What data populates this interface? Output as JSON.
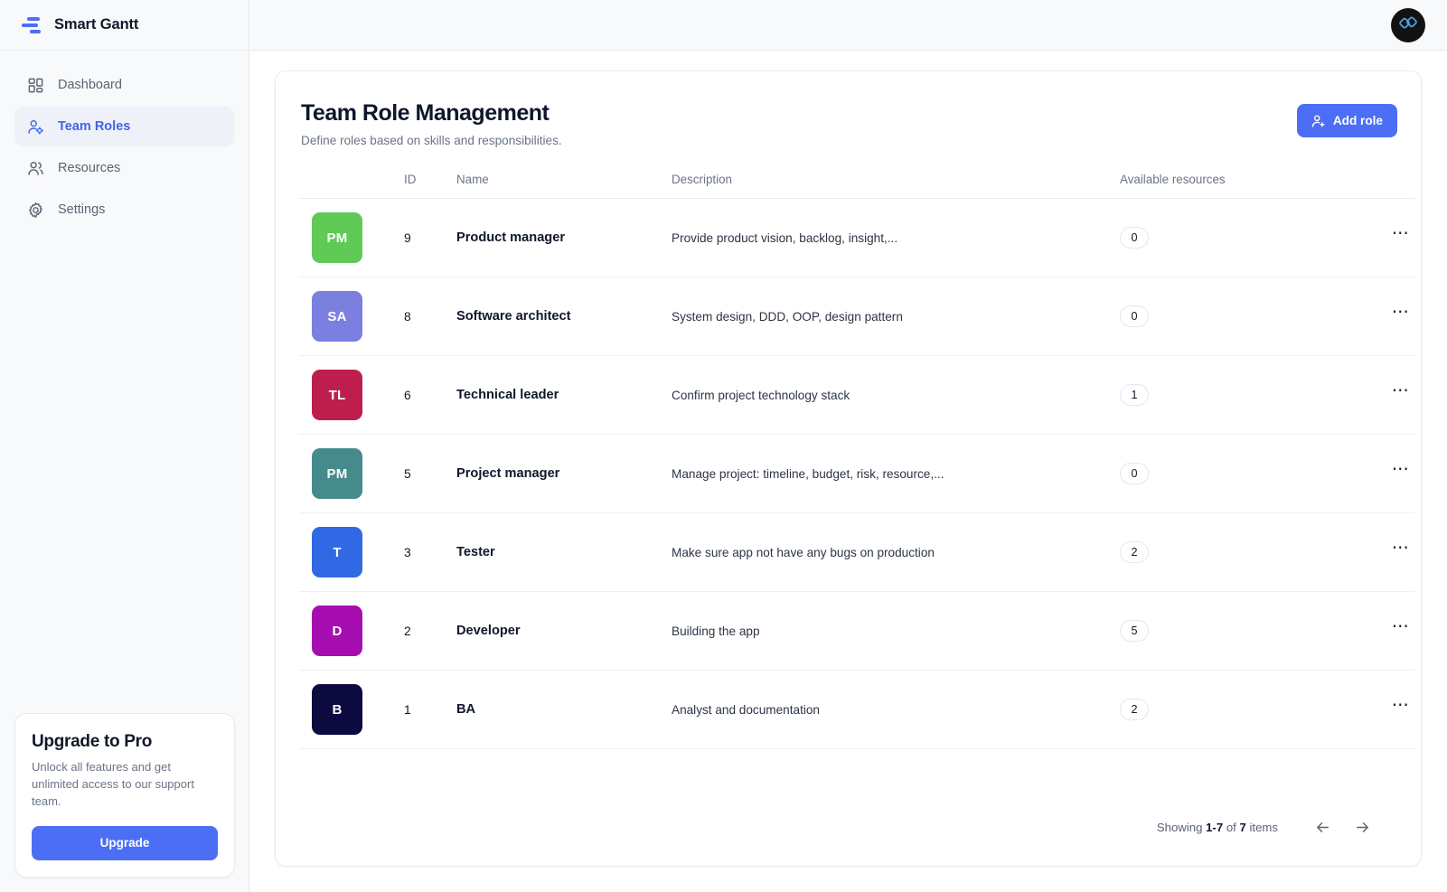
{
  "sidebar": {
    "brand": {
      "name": "Smart Gantt",
      "logo_icon": "gantt-bars-icon"
    },
    "items": [
      {
        "label": "Dashboard",
        "icon": "grid-icon",
        "active": false
      },
      {
        "label": "Team Roles",
        "icon": "user-gear-icon",
        "active": true
      },
      {
        "label": "Resources",
        "icon": "users-icon",
        "active": false
      },
      {
        "label": "Settings",
        "icon": "gear-icon",
        "active": false
      }
    ],
    "upgrade": {
      "title": "Upgrade to Pro",
      "description": "Unlock all features and get unlimited access to our support team.",
      "button_label": "Upgrade"
    }
  },
  "topbar": {
    "avatar_icon": "interlocking-diamonds-logo-icon"
  },
  "page": {
    "title": "Team Role Management",
    "subtitle": "Define roles based on skills and responsibilities.",
    "add_button_label": "Add role",
    "add_button_icon": "user-plus-icon"
  },
  "table": {
    "columns": [
      "",
      "ID",
      "Name",
      "Description",
      "Available resources",
      ""
    ],
    "headers": {
      "avatar": "",
      "id": "ID",
      "name": "Name",
      "description": "Description",
      "resources": "Available resources",
      "actions": ""
    },
    "rows": [
      {
        "initials": "PM",
        "color": "#5FCA56",
        "id": "9",
        "name": "Product manager",
        "description": "Provide product vision, backlog, insight,...",
        "resources": "0",
        "menu_icon": "ellipsis-icon"
      },
      {
        "initials": "SA",
        "color": "#7B7FE0",
        "id": "8",
        "name": "Software architect",
        "description": "System design, DDD, OOP, design pattern",
        "resources": "0",
        "menu_icon": "ellipsis-icon"
      },
      {
        "initials": "TL",
        "color": "#BE1E4E",
        "id": "6",
        "name": "Technical leader",
        "description": "Confirm project technology stack",
        "resources": "1",
        "menu_icon": "ellipsis-icon"
      },
      {
        "initials": "PM",
        "color": "#458B8B",
        "id": "5",
        "name": "Project manager",
        "description": "Manage project: timeline, budget, risk, resource,...",
        "resources": "0",
        "menu_icon": "ellipsis-icon"
      },
      {
        "initials": "T",
        "color": "#3069E3",
        "id": "3",
        "name": "Tester",
        "description": "Make sure app not have any bugs on production",
        "resources": "2",
        "menu_icon": "ellipsis-icon"
      },
      {
        "initials": "D",
        "color": "#A60DB0",
        "id": "2",
        "name": "Developer",
        "description": "Building the app",
        "resources": "5",
        "menu_icon": "ellipsis-icon"
      },
      {
        "initials": "B",
        "color": "#0C0A3E",
        "id": "1",
        "name": "BA",
        "description": "Analyst and documentation",
        "resources": "2",
        "menu_icon": "ellipsis-icon"
      }
    ]
  },
  "pagination": {
    "prefix": "Showing ",
    "range": "1-7",
    "middle": " of ",
    "total": "7",
    "suffix": " items",
    "prev_icon": "arrow-left-icon",
    "next_icon": "arrow-right-icon"
  },
  "colors": {
    "accent": "#4c6ef5",
    "active_nav_text": "#4364e8",
    "active_nav_bg": "#eef1f8",
    "text_primary": "#0f172a",
    "text_muted": "#6b7486",
    "border": "#e8eaef"
  }
}
